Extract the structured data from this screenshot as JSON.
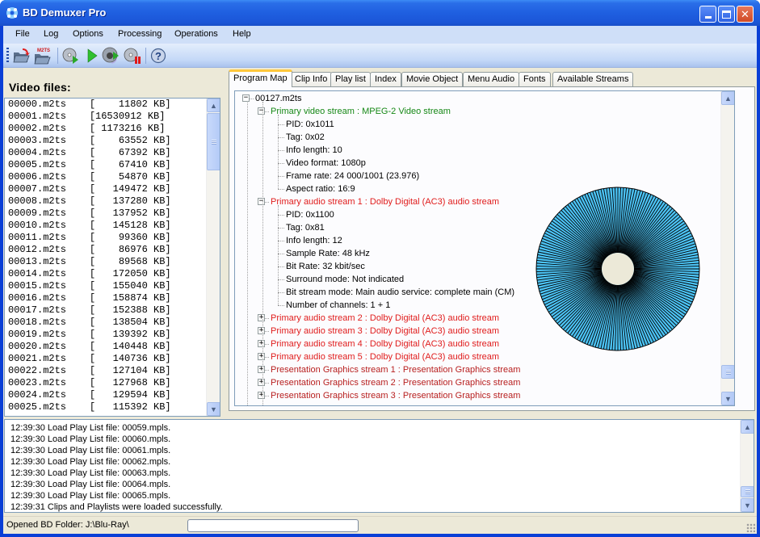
{
  "window": {
    "title": "BD Demuxer Pro",
    "controls": {
      "minimize": "_",
      "maximize": "□",
      "close": "✕"
    }
  },
  "menu": [
    "File",
    "Log",
    "Options",
    "Processing",
    "Operations",
    "Help"
  ],
  "toolbar": {
    "buttons": [
      {
        "name": "open-folder",
        "icon": "folder-open-red-arrow-icon"
      },
      {
        "name": "open-m2ts",
        "icon": "folder-m2ts-icon",
        "badge": "M2TS"
      },
      {
        "name": "disc-play",
        "icon": "disc-play-icon"
      },
      {
        "name": "play",
        "icon": "play-icon"
      },
      {
        "name": "disc-demux",
        "icon": "disc-demux-icon"
      },
      {
        "name": "disc-stop",
        "icon": "disc-stop-icon"
      },
      {
        "name": "help",
        "icon": "help-icon"
      }
    ]
  },
  "video_files": {
    "label": "Video files:",
    "items": [
      "00000.m2ts    [    11802 KB]",
      "00001.m2ts    [16530912 KB]",
      "00002.m2ts    [ 1173216 KB]",
      "00003.m2ts    [    63552 KB]",
      "00004.m2ts    [    67392 KB]",
      "00005.m2ts    [    67410 KB]",
      "00006.m2ts    [    54870 KB]",
      "00007.m2ts    [   149472 KB]",
      "00008.m2ts    [   137280 KB]",
      "00009.m2ts    [   137952 KB]",
      "00010.m2ts    [   145128 KB]",
      "00011.m2ts    [    99360 KB]",
      "00012.m2ts    [    86976 KB]",
      "00013.m2ts    [    89568 KB]",
      "00014.m2ts    [   172050 KB]",
      "00015.m2ts    [   155040 KB]",
      "00016.m2ts    [   158874 KB]",
      "00017.m2ts    [   152388 KB]",
      "00018.m2ts    [   138504 KB]",
      "00019.m2ts    [   139392 KB]",
      "00020.m2ts    [   140448 KB]",
      "00021.m2ts    [   140736 KB]",
      "00022.m2ts    [   127104 KB]",
      "00023.m2ts    [   127968 KB]",
      "00024.m2ts    [   129594 KB]",
      "00025.m2ts    [   115392 KB]"
    ]
  },
  "tabs": [
    "Program Map",
    "Clip Info",
    "Play list",
    "Index",
    "Movie Object",
    "Menu Audio",
    "Fonts",
    "Available Streams"
  ],
  "active_tab": "Program Map",
  "tree": {
    "root": "00127.m2ts",
    "video_stream": {
      "label": "Primary video stream : MPEG-2 Video stream",
      "props": [
        "PID: 0x1011",
        "Tag: 0x02",
        "Info length: 10",
        "Video format: 1080p",
        "Frame rate: 24 000/1001 (23.976)",
        "Aspect ratio: 16:9"
      ]
    },
    "audio_stream_1": {
      "label": "Primary audio stream  1 : Dolby Digital (AC3) audio stream",
      "props": [
        "PID: 0x1100",
        "Tag: 0x81",
        "Info length: 12",
        "Sample Rate: 48 kHz",
        "Bit Rate: 32 kbit/sec",
        "Surround mode: Not indicated",
        "Bit stream mode: Main audio service: complete main (CM)",
        "Number of channels: 1 + 1"
      ]
    },
    "collapsed_audio": [
      "Primary audio stream  2 : Dolby Digital (AC3) audio stream",
      "Primary audio stream  3 : Dolby Digital (AC3) audio stream",
      "Primary audio stream  4 : Dolby Digital (AC3) audio stream",
      "Primary audio stream  5 : Dolby Digital (AC3) audio stream"
    ],
    "collapsed_pg": [
      "Presentation Graphics stream  1 : Presentation Graphics stream",
      "Presentation Graphics stream  2 : Presentation Graphics stream",
      "Presentation Graphics stream  3 : Presentation Graphics stream"
    ]
  },
  "disc_graphic": {
    "fill": "#4cc3f4",
    "hub": "#ece9d8",
    "stroke": "#000000"
  },
  "colors": {
    "video_stream": "#168816",
    "audio_stream": "#e01c1c",
    "pg_stream": "#b82020",
    "titlebar": "#1f5fe0"
  },
  "log": [
    "12:39:30 Load Play List file: 00059.mpls.",
    "12:39:30 Load Play List file: 00060.mpls.",
    "12:39:30 Load Play List file: 00061.mpls.",
    "12:39:30 Load Play List file: 00062.mpls.",
    "12:39:30 Load Play List file: 00063.mpls.",
    "12:39:30 Load Play List file: 00064.mpls.",
    "12:39:30 Load Play List file: 00065.mpls.",
    "12:39:31 Clips and Playlists were loaded successfully."
  ],
  "status": {
    "text": "Opened BD Folder:    J:\\Blu-Ray\\",
    "progress": 0
  }
}
